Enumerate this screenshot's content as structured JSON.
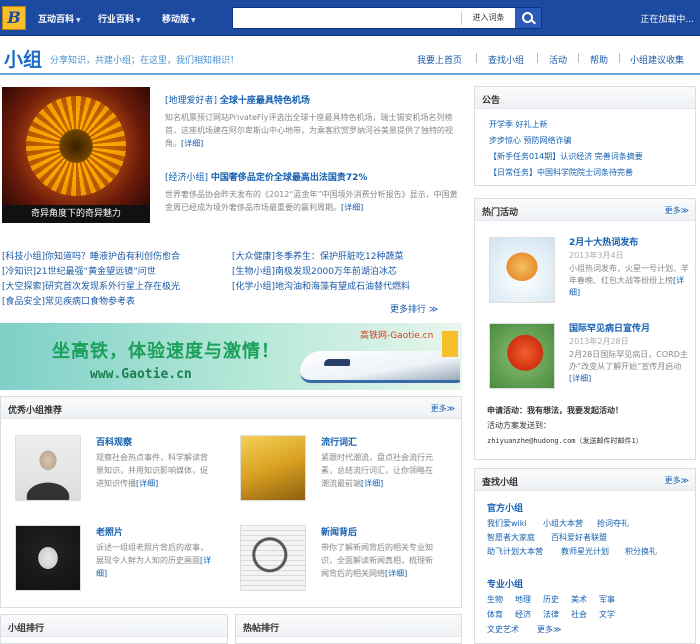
{
  "topbar": {
    "logo": "B",
    "nav": [
      "互动百科",
      "行业百科",
      "移动版"
    ],
    "search_placeholder": "",
    "search_button": "进入词条",
    "loading": "正在加载中..."
  },
  "header": {
    "title": "小组",
    "slogan": "分享知识，共建小组；在这里，我们相知相识！",
    "nav": [
      "我要上首页",
      "查找小组",
      "活动",
      "帮助",
      "小组建议收集"
    ]
  },
  "featured": {
    "caption": "奇异角度下的奇异魅力",
    "articles": [
      {
        "tag": "[地理爱好者]",
        "title": "全球十座最具特色机场",
        "desc": "知名机票预订网站PrivateFly评选出全球十座最具特色机场，瑞士锡安机场名列榜首，这座机场建在阿尔卑斯山中心地带，为乘客欣赏罗纳河谷美景提供了独特的视角。",
        "more": "[详细]"
      },
      {
        "tag": "[经济小组]",
        "title": "中国奢侈品定价全球最高出法国贵72%",
        "desc": "世界奢侈品协会昨天发布的《2012“蓝金年”中国境外消费分析报告》显示，中国黄金周已经成为境外奢侈品市场最重要的赢利周期。",
        "more": "[详细]"
      }
    ]
  },
  "tag_links": [
    [
      {
        "tag": "[科技小组]",
        "title": "你知道吗？睡液护齿有利创伤愈合"
      },
      {
        "tag": "[大众健康]",
        "title": "冬季养生：保护肝脏吃12种蔬菜"
      }
    ],
    [
      {
        "tag": "[冷知识]",
        "title": "21世纪最强“黄金望远镜”问世"
      },
      {
        "tag": "[生物小组]",
        "title": "南极发现2000万年前湖泊冰芯"
      }
    ],
    [
      {
        "tag": "[大空探索]",
        "title": "研究首次发现系外行星上存在极光"
      },
      {
        "tag": "[化学小组]",
        "title": "地沟油和海藻有望成石油替代燃料"
      }
    ],
    [
      {
        "tag": "[食品安全]",
        "title": "常见疾病口食物参考表"
      }
    ]
  ],
  "more_label": "更多排行",
  "banner": {
    "text": "坐高铁，体验速度与激情！",
    "url": "www.Gaotie.cn",
    "label": "高铁网-Gaotie.cn"
  },
  "groups": {
    "title": "优秀小组推荐",
    "more": "更多≫",
    "items": [
      {
        "name": "百科观察",
        "desc": "观察社会热点事件，科学解读背景知识，并用知识影响媒体，促进知识传播",
        "more": "[详细]"
      },
      {
        "name": "流行词汇",
        "desc": "紧跟时代潮流，盘点社会流行元素，总结流行词汇，让你领略在潮流最前端",
        "more": "[详细]"
      },
      {
        "name": "老照片",
        "desc": "诉述一组组老照片背后的故事，展现令人鲜为人知的历史画面",
        "more": "[详细]"
      },
      {
        "name": "新闻背后",
        "desc": "带你了解新闻背后的相关专业知识，全面解读新闻真相，梳理新闻背后的相关网络",
        "more": "[详细]"
      }
    ]
  },
  "rank_tabs": [
    "小组排行",
    "热帖排行"
  ],
  "announce": {
    "title": "公告",
    "items": [
      "开学季 好礼上新",
      "步步惊心 预防网络诈骗",
      "【新手任务014期】认识经济 完善词条摘要",
      "【日常任务】中国科学院院士词条待完善"
    ]
  },
  "events": {
    "title": "热门活动",
    "more": "更多≫",
    "items": [
      {
        "name": "2月十大热词发布",
        "date": "2013年3月4日",
        "desc": "小组热词发布，火星一号计划、羊年春晚、红包大战等纷纷上榜",
        "more": "[详细]"
      },
      {
        "name": "国际罕见病日宣传月",
        "date": "2013年2月28日",
        "desc": "2月28日国际罕见病日，CORD主办“改变从了解开始”宣传月启动",
        "more": "[详细]"
      }
    ],
    "apply": "申请活动：我有想法，我要发起活动！",
    "contact_label": "活动方案发送到：",
    "email": "zhiyuanzhe@hudong.com（发送邮件时邮件1）"
  },
  "find": {
    "title": "查找小组",
    "more": "更多≫",
    "official_title": "官方小组",
    "official": [
      "我们爱wiki",
      "小组大本营",
      "抢词夺礼",
      "智愿者大家庭",
      "百科爱好者联盟",
      "助飞计划大本营",
      "教师星光计划",
      "积分换礼"
    ],
    "pro_title": "专业小组",
    "pro": [
      "生物",
      "地理",
      "历史",
      "美术",
      "军事",
      "体育",
      "经济",
      "法律",
      "社会",
      "文学",
      "文史艺术",
      "更多≫"
    ]
  }
}
